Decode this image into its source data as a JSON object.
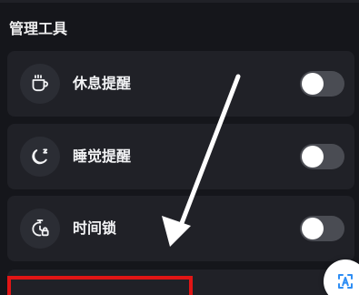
{
  "section": {
    "title": "管理工具"
  },
  "items": [
    {
      "label": "休息提醒",
      "icon": "coffee-cup-icon",
      "toggle_on": false
    },
    {
      "label": "睡觉提醒",
      "icon": "moon-sleep-icon",
      "toggle_on": false
    },
    {
      "label": "时间锁",
      "icon": "timer-lock-icon",
      "toggle_on": false
    }
  ],
  "colors": {
    "background": "#15161b",
    "card": "#202127",
    "icon_circle": "#2b2d34",
    "toggle_off": "#4a4c53",
    "annotation_red": "#e11515",
    "arrow": "#ffffff"
  },
  "annotations": {
    "arrow_icon": "arrow-down-left-annotation",
    "highlight": "red-highlight-box"
  },
  "floating_button": {
    "icon": "text-scan-icon"
  }
}
